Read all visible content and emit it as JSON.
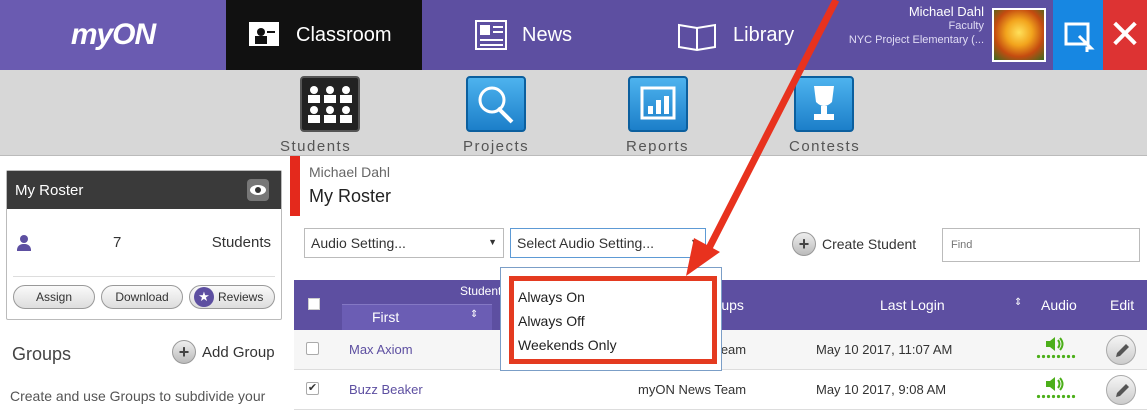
{
  "app": {
    "logo": "myON"
  },
  "nav": {
    "tabs": [
      {
        "label": "Classroom",
        "icon": "classroom-icon",
        "active": true
      },
      {
        "label": "News",
        "icon": "news-icon",
        "active": false
      },
      {
        "label": "Library",
        "icon": "library-icon",
        "active": false
      }
    ]
  },
  "user": {
    "name": "Michael Dahl",
    "role": "Faculty",
    "school": "NYC Project Elementary (..."
  },
  "subnav": {
    "items": [
      {
        "label": "Students",
        "icon": "students-icon",
        "active": true
      },
      {
        "label": "Projects",
        "icon": "projects-icon",
        "active": false
      },
      {
        "label": "Reports",
        "icon": "reports-icon",
        "active": false
      },
      {
        "label": "Contests",
        "icon": "contests-icon",
        "active": false
      }
    ]
  },
  "roster_card": {
    "title": "My Roster",
    "count": "7",
    "count_label": "Students",
    "buttons": {
      "assign": "Assign",
      "download": "Download",
      "reviews": "Reviews"
    }
  },
  "groups": {
    "title": "Groups",
    "add_label": "Add Group",
    "description": "Create and use Groups to subdivide your"
  },
  "main": {
    "teacher": "Michael Dahl",
    "title": "My Roster",
    "audio_select_1": "Audio Setting...",
    "audio_select_2": "Select Audio Setting...",
    "create_student": "Create Student",
    "find_placeholder": "Find"
  },
  "dropdown": {
    "options": [
      "Always On",
      "Always Off",
      "Weekends Only"
    ]
  },
  "table": {
    "headers": {
      "students": "Students",
      "first": "First",
      "groups": "Groups",
      "last_login": "Last Login",
      "audio": "Audio",
      "edit": "Edit"
    },
    "rows": [
      {
        "first": "Max Axiom",
        "group": "myON News Team",
        "last_login": "May 10 2017, 11:07 AM",
        "checked": false
      },
      {
        "first": "Buzz Beaker",
        "group": "myON News Team",
        "last_login": "May 10 2017, 9:08 AM",
        "checked": true
      }
    ]
  },
  "colors": {
    "brand_purple": "#5d4fa1",
    "highlight_red": "#e43a20",
    "audio_green": "#4caf1a"
  }
}
